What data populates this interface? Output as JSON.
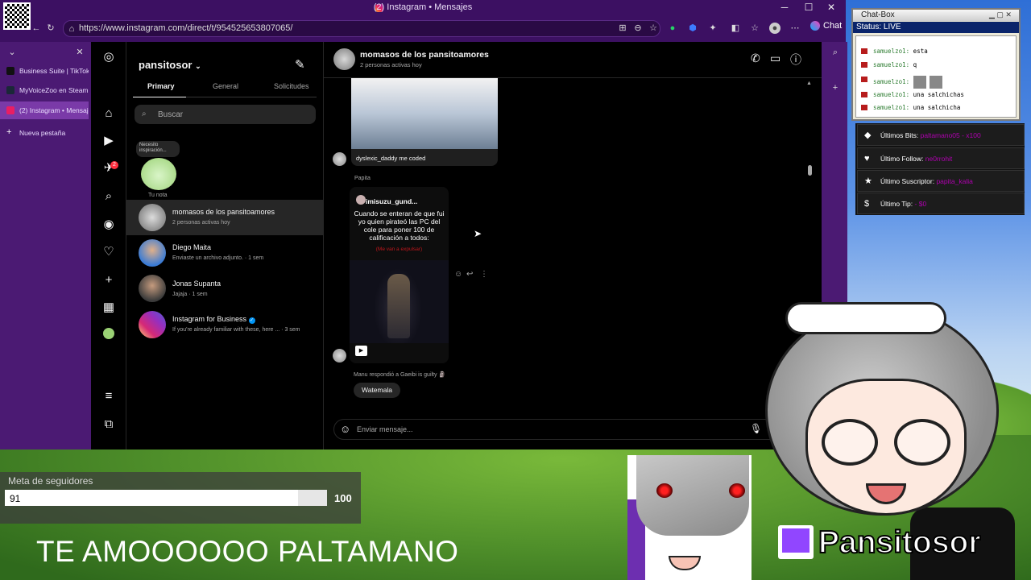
{
  "browser": {
    "tab_title": "(2) Instagram • Mensajes",
    "url": "https://www.instagram.com/direct/t/954525653807065/",
    "chat_button": "Chat",
    "tabs": [
      {
        "label": "Business Suite | TikTok",
        "color": "#111111"
      },
      {
        "label": "MyVoiceZoo en Steam",
        "color": "#1b2838"
      },
      {
        "label": "(2) Instagram • Mensajes",
        "color": "#e91e63"
      },
      {
        "label": "Nueva pestaña",
        "color": "#4b1a73"
      }
    ]
  },
  "instagram": {
    "username": "pansitosor",
    "tabs": [
      "Primary",
      "General",
      "Solicitudes"
    ],
    "search_placeholder": "Buscar",
    "note": {
      "bubble": "Necesito inspiración...",
      "label": "Tu nota"
    },
    "notification_badge": "2",
    "conversations": [
      {
        "name": "momasos de los pansitoamores",
        "sub": "2 personas activas hoy",
        "selected": true
      },
      {
        "name": "Diego Maita",
        "sub": "Enviaste un archivo adjunto. · 1 sem"
      },
      {
        "name": "Jonas Supanta",
        "sub": "Jajaja · 1 sem"
      },
      {
        "name": "Instagram for Business",
        "sub": "If you're already familiar with these, here ... · 3 sem",
        "verified": true
      }
    ],
    "chat": {
      "title": "momasos de los pansitoamores",
      "status": "2 personas activas hoy",
      "msg1_caption": "dyslexic_daddy me coded",
      "sender2": "Papita",
      "reel_user": "imisuzu_gund...",
      "reel_text": "Cuando se enteran de que fui yo quien pirateó las PC del cole para poner 100 de calificación a todos:",
      "reel_red": "(Me van a expulsar)",
      "reply_note": "Manu respondió a Gaeibi is guilty 🗿",
      "reply_bubble": "Watemala",
      "composer_placeholder": "Enviar mensaje..."
    }
  },
  "chatbox": {
    "title": "Chat-Box",
    "status": "Status: LIVE",
    "lines": [
      {
        "user": "samuelzo1:",
        "text": "esta"
      },
      {
        "user": "samuelzo1:",
        "text": "q"
      },
      {
        "user": "samuelzo1:",
        "text": ""
      },
      {
        "user": "samuelzo1:",
        "text": "una salchichas"
      },
      {
        "user": "samuelzo1:",
        "text": "una salchicha"
      }
    ]
  },
  "stats": [
    {
      "label": "Últimos Bits:",
      "value": "paltamano05 - x100"
    },
    {
      "label": "Último Follow:",
      "value": "ne0rrohit"
    },
    {
      "label": "Último Suscriptor:",
      "value": "papita_kalia"
    },
    {
      "label": "Último Tip:",
      "value": "- $0"
    }
  ],
  "goal": {
    "label": "Meta de seguidores",
    "current": "91",
    "max": "100",
    "progress": 0.91
  },
  "banner": "TE AMOOOOOO PALTAMANO",
  "channel": "Pansitosor"
}
